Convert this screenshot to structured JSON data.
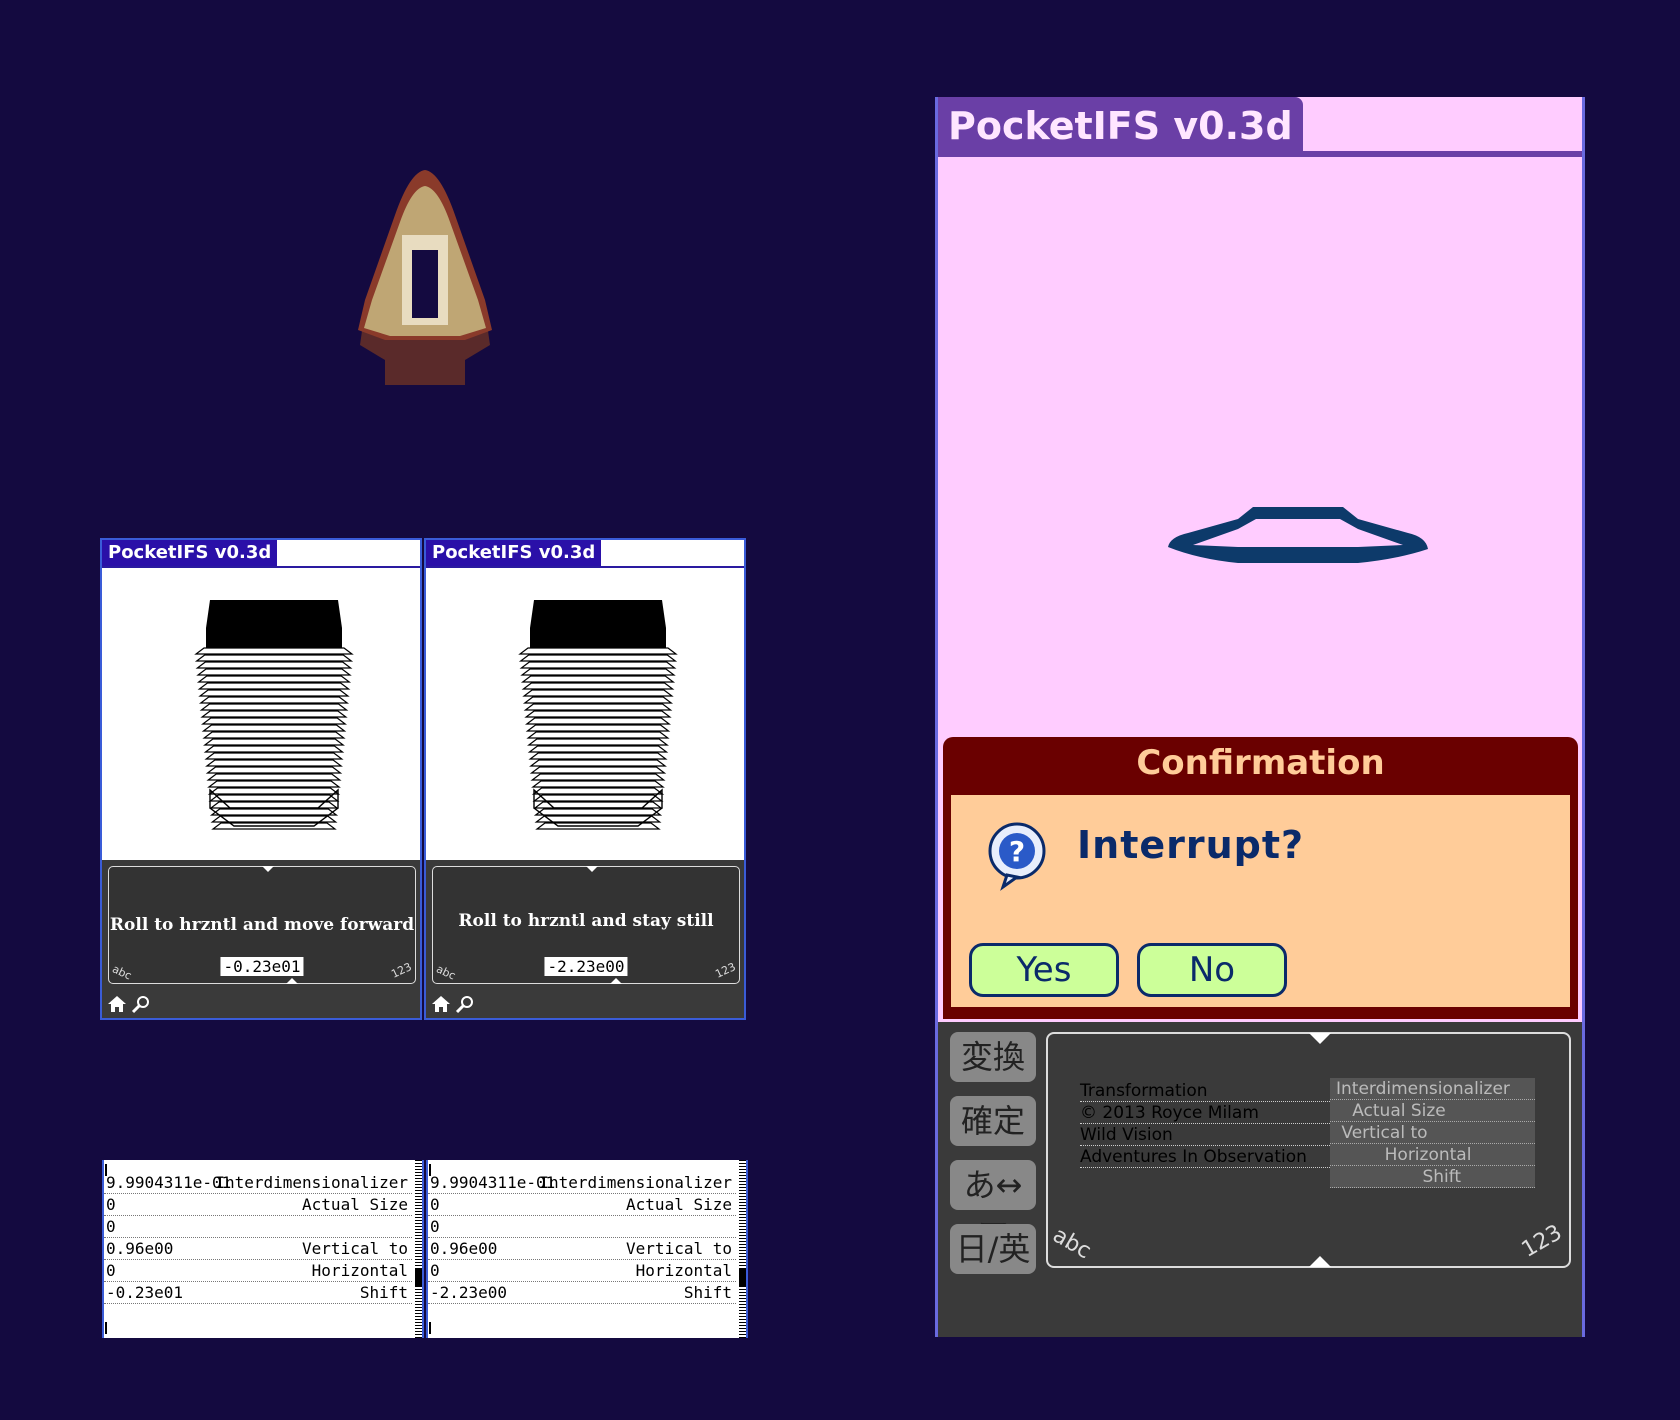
{
  "app": {
    "title": "PocketIFS v0.3d"
  },
  "panel_left": {
    "graffiti_caption": "Roll to hrzntl and move forward",
    "value": "-0.23e01",
    "abc_label": "abc",
    "num_label": "123"
  },
  "panel_right": {
    "graffiti_caption": "Roll to hrzntl and stay still",
    "value": "-2.23e00",
    "abc_label": "abc",
    "num_label": "123"
  },
  "listing_left": {
    "rows": [
      {
        "value": "9.9904311e-01",
        "key": "Interdimensionalizer"
      },
      {
        "value": "0",
        "key": "Actual Size"
      },
      {
        "value": "0",
        "key": ""
      },
      {
        "value": "0.96e00",
        "key": "Vertical to"
      },
      {
        "value": "0",
        "key": "Horizontal"
      },
      {
        "value": "-0.23e01",
        "key": "Shift"
      }
    ]
  },
  "listing_right": {
    "rows": [
      {
        "value": "9.9904311e-01",
        "key": "Interdimensionalizer"
      },
      {
        "value": "0",
        "key": "Actual Size"
      },
      {
        "value": "0",
        "key": ""
      },
      {
        "value": "0.96e00",
        "key": "Vertical to"
      },
      {
        "value": "0",
        "key": "Horizontal"
      },
      {
        "value": "-2.23e00",
        "key": "Shift"
      }
    ]
  },
  "big_screen": {
    "dialog": {
      "title": "Confirmation",
      "message": "Interrupt?",
      "yes_label": "Yes",
      "no_label": "No"
    },
    "ime_buttons": [
      "変換",
      "確定",
      "あ↔ア",
      "日/英"
    ],
    "menu": [
      "Transformation",
      "© 2013  Royce Milam",
      "Wild Vision",
      "Adventures In Observation"
    ],
    "params": [
      "Interdimensionalizer",
      "   Actual Size",
      " Vertical to",
      "         Horizontal",
      "                Shift"
    ],
    "abc_label": "abc",
    "num_label": "123"
  },
  "colors": {
    "background": "#140a40",
    "title_bar_small": "#2a10a8",
    "big_screen_bg": "#ffccff",
    "big_title_bar": "#6a3fa6",
    "dialog_frame": "#6a0000",
    "dialog_body": "#ffcc99",
    "button_fill": "#ccff99",
    "text_dark_blue": "#0a2a6a"
  },
  "icons": [
    "ufo-glyph-icon",
    "home-icon",
    "find-icon",
    "question-icon"
  ]
}
